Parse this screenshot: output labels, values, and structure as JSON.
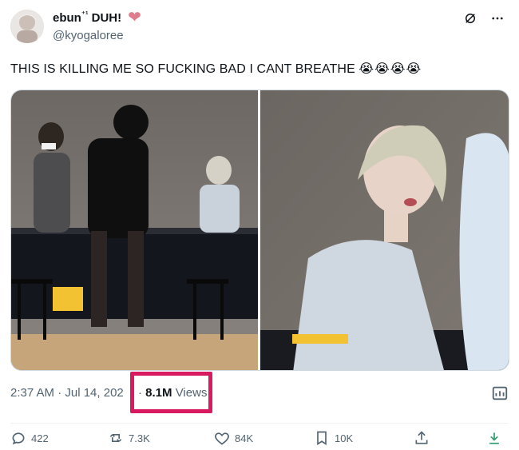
{
  "author": {
    "display_name": "ebun",
    "badge": "⁺¹",
    "display_name_suffix": "DUH!",
    "heart": "❤",
    "handle": "@kyogaloree"
  },
  "tweet": {
    "text": "THIS IS KILLING ME SO FUCKING BAD I CANT BREATHE",
    "emojis": "😭😭😭😭"
  },
  "meta": {
    "timestamp": "2:37 AM · Jul 14, 202",
    "sep": "·",
    "views_count": "8.1M",
    "views_label": "Views"
  },
  "actions": {
    "replies": "422",
    "reposts": "7.3K",
    "likes": "84K",
    "bookmarks": "10K"
  },
  "colors": {
    "highlight_box": "#d81b60",
    "muted_text": "#536471",
    "text": "#0f1419"
  },
  "icons": [
    "more-icon",
    "grok-icon",
    "analytics-icon",
    "reply-icon",
    "repost-icon",
    "like-icon",
    "bookmark-icon",
    "share-icon",
    "download-icon"
  ]
}
